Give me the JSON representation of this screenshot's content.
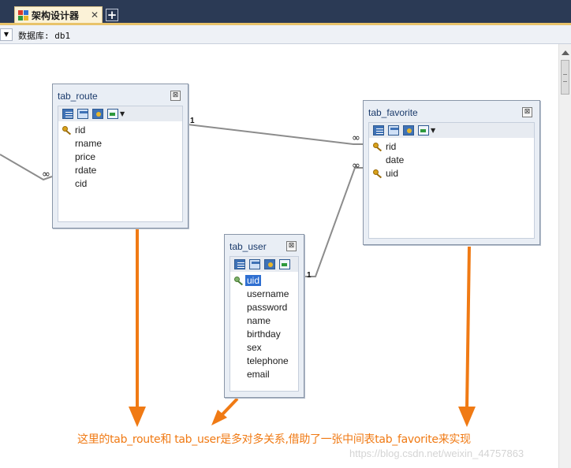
{
  "editor_tab": {
    "label": "架构设计器",
    "close_glyph": "✕",
    "add_glyph": "+",
    "icon": "schema-designer-icon"
  },
  "database_bar": {
    "label": "数据库: db1",
    "dropdown_glyph": "▼"
  },
  "tables": {
    "route": {
      "title": "tab_route",
      "close_glyph": "⊠",
      "fields": [
        {
          "name": "rid",
          "key": true
        },
        {
          "name": "rname",
          "key": false
        },
        {
          "name": "price",
          "key": false
        },
        {
          "name": "rdate",
          "key": false
        },
        {
          "name": "cid",
          "key": false
        }
      ]
    },
    "favorite": {
      "title": "tab_favorite",
      "close_glyph": "⊠",
      "fields": [
        {
          "name": "rid",
          "key": true
        },
        {
          "name": "date",
          "key": false
        },
        {
          "name": "uid",
          "key": true
        }
      ]
    },
    "user": {
      "title": "tab_user",
      "close_glyph": "⊠",
      "fields": [
        {
          "name": "uid",
          "key": true,
          "selected": true
        },
        {
          "name": "username",
          "key": false
        },
        {
          "name": "password",
          "key": false
        },
        {
          "name": "name",
          "key": false
        },
        {
          "name": "birthday",
          "key": false
        },
        {
          "name": "sex",
          "key": false
        },
        {
          "name": "telephone",
          "key": false
        },
        {
          "name": "email",
          "key": false
        }
      ]
    }
  },
  "relations": {
    "one": "1",
    "many": "∞"
  },
  "annotation": {
    "text": "这里的tab_route和 tab_user是多对多关系,借助了一张中间表tab_favorite来实现",
    "color": "#f07a14"
  },
  "watermark": "https://blog.csdn.net/weixin_44757863"
}
